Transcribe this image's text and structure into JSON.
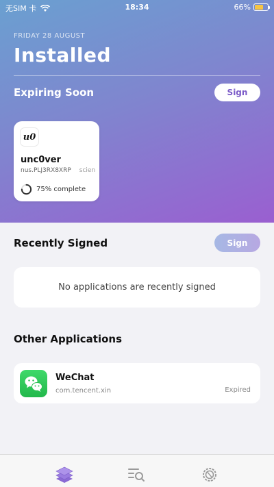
{
  "status_bar": {
    "carrier": "无SIM 卡",
    "time": "18:34",
    "battery_percent": "66%",
    "battery_level": 0.66,
    "battery_color": "#f6c445"
  },
  "header": {
    "date": "FRIDAY 28 AUGUST",
    "title": "Installed"
  },
  "expiring": {
    "title": "Expiring Soon",
    "sign_label": "Sign",
    "apps": [
      {
        "icon_text": "u0",
        "name": "unc0ver",
        "bundle": "nus.PLJ3RX8XRP",
        "bundle_extra": "scien",
        "progress_text": "75% complete",
        "progress": 0.75
      }
    ]
  },
  "recent": {
    "title": "Recently Signed",
    "sign_label": "Sign",
    "empty_text": "No applications are recently signed"
  },
  "other": {
    "title": "Other Applications",
    "apps": [
      {
        "icon": "wechat-icon",
        "name": "WeChat",
        "bundle": "com.tencent.xin",
        "status": "Expired"
      }
    ]
  },
  "tabbar": {
    "items": [
      {
        "icon": "layers-icon",
        "active": true
      },
      {
        "icon": "search-list-icon",
        "active": false
      },
      {
        "icon": "settings-gear-icon",
        "active": false
      }
    ]
  },
  "colors": {
    "accent": "#7a5ac8",
    "hero_start": "#6aa0d0",
    "hero_end": "#9a5fd0"
  }
}
